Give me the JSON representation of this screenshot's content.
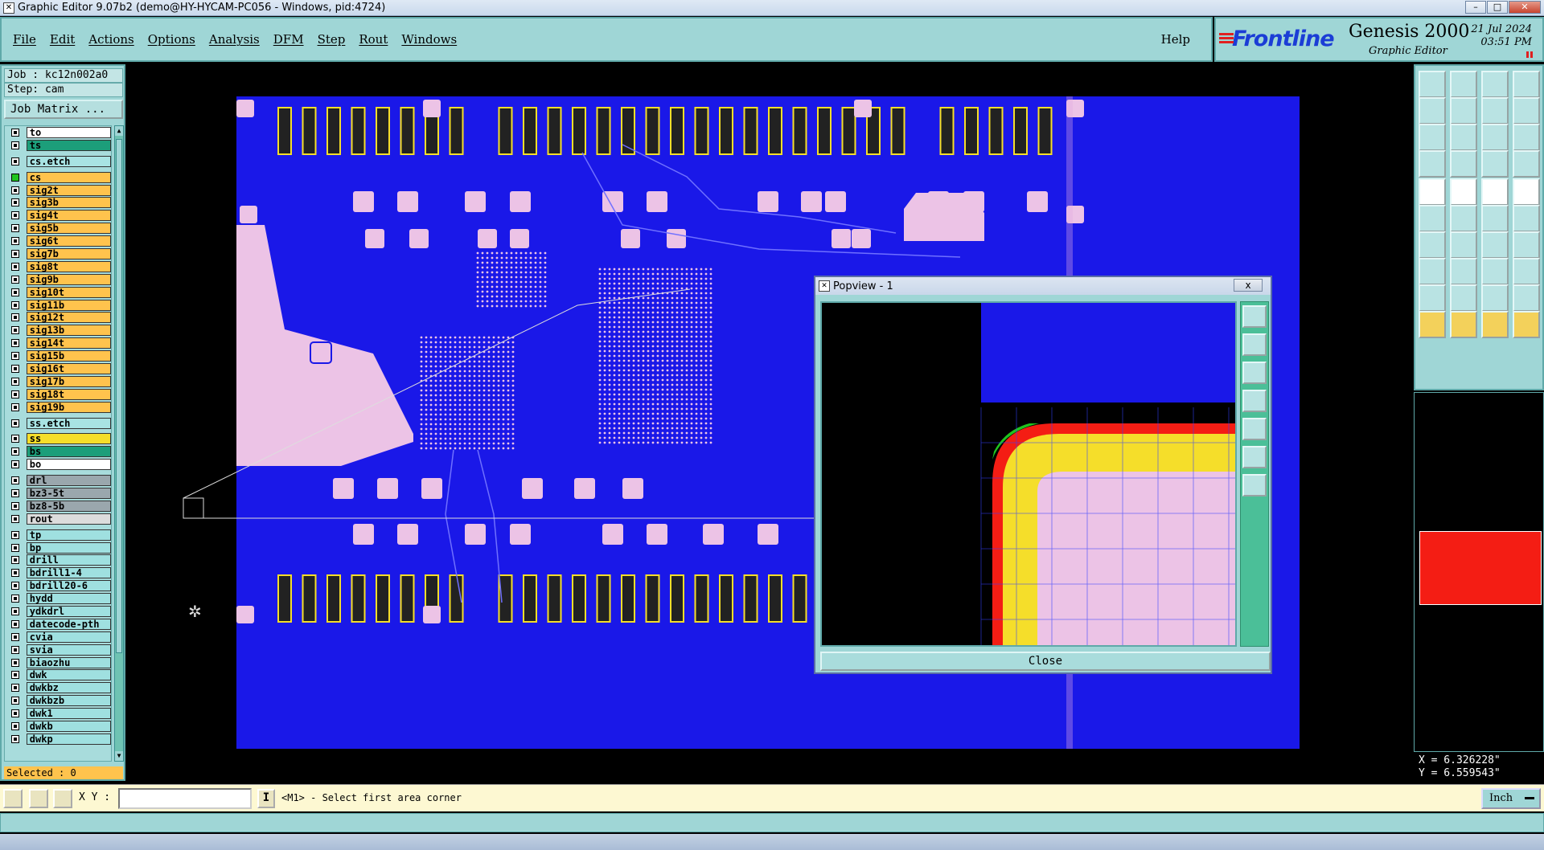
{
  "window": {
    "title": "Graphic Editor 9.07b2 (demo@HY-HYCAM-PC056 - Windows, pid:4724)"
  },
  "menu": {
    "items": [
      "File",
      "Edit",
      "Actions",
      "Options",
      "Analysis",
      "DFM",
      "Step",
      "Rout",
      "Windows"
    ],
    "help": "Help"
  },
  "brand": {
    "logo": "Frontline",
    "product": "Genesis 2000",
    "subtitle": "Graphic Editor",
    "date": "21 Jul 2024",
    "time": "03:51 PM"
  },
  "job": {
    "job_label": "Job : kc12n002a0",
    "step_label": "Step: cam",
    "matrix_button": "Job Matrix ..."
  },
  "layers": [
    {
      "name": "to",
      "color": "white",
      "active": false,
      "sep_before": false
    },
    {
      "name": "ts",
      "color": "green",
      "active": false,
      "sep_before": false
    },
    {
      "name": "cs.etch",
      "color": "teal",
      "active": false,
      "sep_before": true
    },
    {
      "name": "cs",
      "color": "orange",
      "active": true,
      "sep_before": true
    },
    {
      "name": "sig2t",
      "color": "orange",
      "active": false,
      "sep_before": false
    },
    {
      "name": "sig3b",
      "color": "orange",
      "active": false,
      "sep_before": false
    },
    {
      "name": "sig4t",
      "color": "orange",
      "active": false,
      "sep_before": false
    },
    {
      "name": "sig5b",
      "color": "orange",
      "active": false,
      "sep_before": false
    },
    {
      "name": "sig6t",
      "color": "orange",
      "active": false,
      "sep_before": false
    },
    {
      "name": "sig7b",
      "color": "orange",
      "active": false,
      "sep_before": false
    },
    {
      "name": "sig8t",
      "color": "orange",
      "active": false,
      "sep_before": false
    },
    {
      "name": "sig9b",
      "color": "orange",
      "active": false,
      "sep_before": false
    },
    {
      "name": "sig10t",
      "color": "orange",
      "active": false,
      "sep_before": false
    },
    {
      "name": "sig11b",
      "color": "orange",
      "active": false,
      "sep_before": false
    },
    {
      "name": "sig12t",
      "color": "orange",
      "active": false,
      "sep_before": false
    },
    {
      "name": "sig13b",
      "color": "orange",
      "active": false,
      "sep_before": false
    },
    {
      "name": "sig14t",
      "color": "orange",
      "active": false,
      "sep_before": false
    },
    {
      "name": "sig15b",
      "color": "orange",
      "active": false,
      "sep_before": false
    },
    {
      "name": "sig16t",
      "color": "orange",
      "active": false,
      "sep_before": false
    },
    {
      "name": "sig17b",
      "color": "orange",
      "active": false,
      "sep_before": false
    },
    {
      "name": "sig18t",
      "color": "orange",
      "active": false,
      "sep_before": false
    },
    {
      "name": "sig19b",
      "color": "orange",
      "active": false,
      "sep_before": false
    },
    {
      "name": "ss.etch",
      "color": "teal",
      "active": false,
      "sep_before": true
    },
    {
      "name": "ss",
      "color": "yellow",
      "active": false,
      "sep_before": true
    },
    {
      "name": "bs",
      "color": "green",
      "active": false,
      "sep_before": false
    },
    {
      "name": "bo",
      "color": "white",
      "active": false,
      "sep_before": false
    },
    {
      "name": "drl",
      "color": "grey",
      "active": false,
      "sep_before": true
    },
    {
      "name": "bz3-5t",
      "color": "grey",
      "active": false,
      "sep_before": false
    },
    {
      "name": "bz8-5b",
      "color": "grey",
      "active": false,
      "sep_before": false
    },
    {
      "name": "rout",
      "color": "light",
      "active": false,
      "sep_before": false
    },
    {
      "name": "tp",
      "color": "cyan",
      "active": false,
      "sep_before": true
    },
    {
      "name": "bp",
      "color": "cyan",
      "active": false,
      "sep_before": false
    },
    {
      "name": "drill",
      "color": "cyan",
      "active": false,
      "sep_before": false
    },
    {
      "name": "bdrill1-4",
      "color": "cyan",
      "active": false,
      "sep_before": false
    },
    {
      "name": "bdrill20-6",
      "color": "cyan",
      "active": false,
      "sep_before": false
    },
    {
      "name": "hydd",
      "color": "cyan",
      "active": false,
      "sep_before": false
    },
    {
      "name": "ydkdrl",
      "color": "cyan",
      "active": false,
      "sep_before": false
    },
    {
      "name": "datecode-pth",
      "color": "cyan",
      "active": false,
      "sep_before": false
    },
    {
      "name": "cvia",
      "color": "cyan",
      "active": false,
      "sep_before": false
    },
    {
      "name": "svia",
      "color": "cyan",
      "active": false,
      "sep_before": false
    },
    {
      "name": "biaozhu",
      "color": "cyan",
      "active": false,
      "sep_before": false
    },
    {
      "name": "dwk",
      "color": "cyan",
      "active": false,
      "sep_before": false
    },
    {
      "name": "dwkbz",
      "color": "cyan",
      "active": false,
      "sep_before": false
    },
    {
      "name": "dwkbzb",
      "color": "cyan",
      "active": false,
      "sep_before": false
    },
    {
      "name": "dwk1",
      "color": "cyan",
      "active": false,
      "sep_before": false
    },
    {
      "name": "dwkb",
      "color": "cyan",
      "active": false,
      "sep_before": false
    },
    {
      "name": "dwkp",
      "color": "cyan",
      "active": false,
      "sep_before": false
    }
  ],
  "selected": "Selected : 0",
  "popview": {
    "title": "Popview - 1",
    "close_icon": "x",
    "close_button": "Close"
  },
  "coords": {
    "x": "X = 6.326228\"",
    "y": "Y = 6.559543\""
  },
  "status": {
    "xy_label": "X Y :",
    "xy_value": "",
    "message": "<M1> - Select first area corner",
    "unit": "Inch"
  },
  "colors": {
    "board": "#1a18e8",
    "pad": "#ecc3e6",
    "copper_edge": "#f41d14",
    "yellow": "#f5de2a",
    "green": "#1fc41f",
    "panel": "#9fd6d6"
  }
}
